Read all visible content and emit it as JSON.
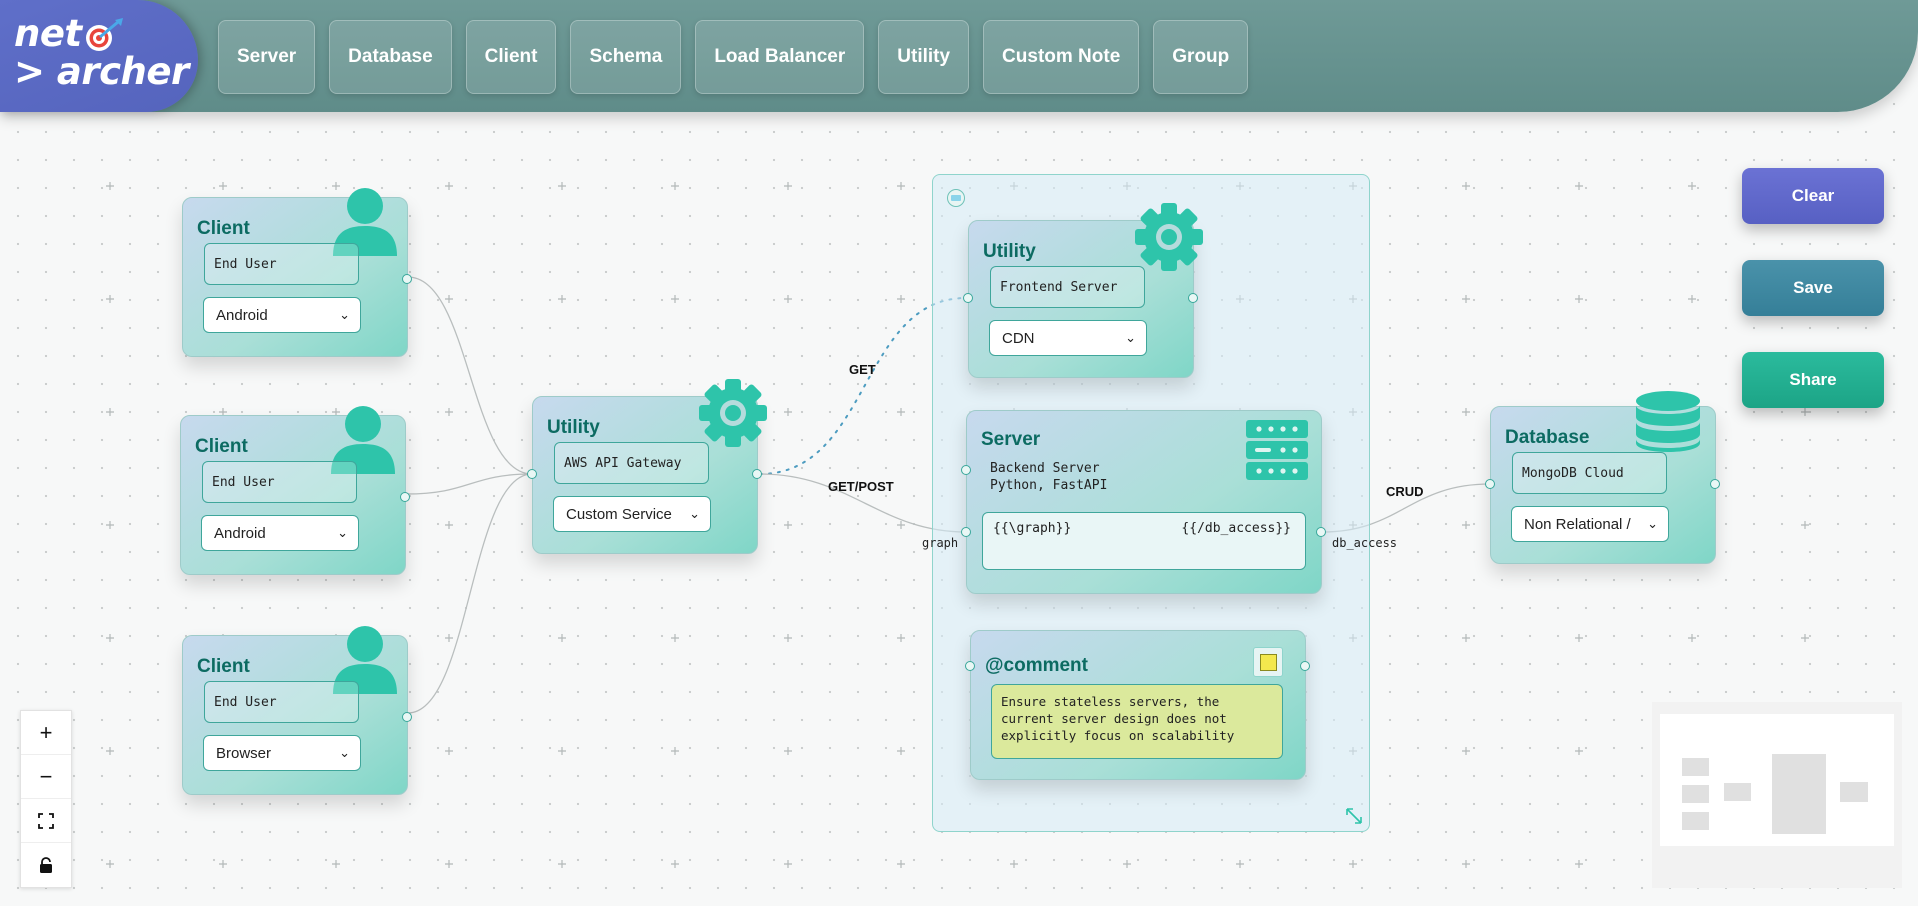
{
  "app": {
    "logo_line1": "net",
    "logo_line2": "> archer"
  },
  "nav": [
    "Server",
    "Database",
    "Client",
    "Schema",
    "Load Balancer",
    "Utility",
    "Custom Note",
    "Group"
  ],
  "actions": {
    "clear": "Clear",
    "save": "Save",
    "share": "Share"
  },
  "colors": {
    "clear": "#5b63c6",
    "save": "#3a8fa3",
    "share": "#1fae92",
    "accent": "#2ec4aa"
  },
  "clients": [
    {
      "title": "Client",
      "field": "End User",
      "select": "Android"
    },
    {
      "title": "Client",
      "field": "End User",
      "select": "Android"
    },
    {
      "title": "Client",
      "field": "End User",
      "select": "Browser"
    }
  ],
  "gateway": {
    "title": "Utility",
    "field": "AWS API Gateway",
    "select": "Custom Service"
  },
  "frontend": {
    "title": "Utility",
    "field": "Frontend Server",
    "select": "CDN"
  },
  "server": {
    "title": "Server",
    "desc_line1": "Backend Server",
    "desc_line2": "Python, FastAPI",
    "code_left": "{{\\graph}}",
    "code_right": "{{/db_access}}",
    "handle_left": "graph",
    "handle_right": "db_access"
  },
  "comment": {
    "title": "@comment",
    "text_line1": "Ensure stateless servers, the",
    "text_line2": "current server design does not",
    "text_line3": "explicitly focus on scalability"
  },
  "database": {
    "title": "Database",
    "field": "MongoDB Cloud",
    "select": "Non Relational /"
  },
  "edges": {
    "get": "GET",
    "getpost": "GET/POST",
    "crud": "CRUD"
  },
  "controls": {
    "zoom_in": "+",
    "zoom_out": "−"
  }
}
